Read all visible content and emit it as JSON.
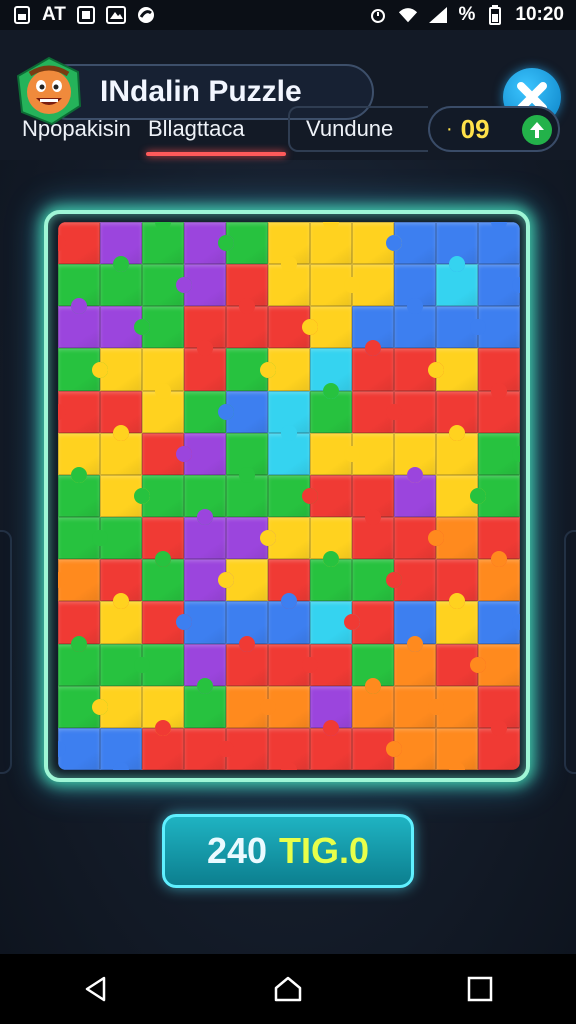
{
  "status_bar": {
    "left_text": "AT",
    "battery_percent": "%",
    "time": "10:20",
    "icons": [
      "sim-icon",
      "image-icon",
      "photo-icon",
      "brand-icon",
      "alarm-icon",
      "wifi-icon",
      "signal-icon",
      "battery-icon"
    ]
  },
  "header": {
    "title": "INdalin Puzzle",
    "avatar_icon": "cartoon-face-icon",
    "close_icon": "puzzle-close-icon"
  },
  "tabs": [
    {
      "label": "Npopakisin"
    },
    {
      "label": "Bllagttaca"
    },
    {
      "label": "Vundune"
    }
  ],
  "score": {
    "value": "09",
    "icon": "up-arrow-icon"
  },
  "board": {
    "rows": 13,
    "cols": 11,
    "palette": {
      "r": "#f03a34",
      "g": "#27c23f",
      "b": "#3d7ff0",
      "y": "#ffd21f",
      "o": "#ff8a1e",
      "p": "#9b45dd",
      "c": "#35d3f0"
    },
    "pieces": [
      "rpgpgyyybbb",
      "gggpryyybcb",
      "ppgrrrybbbb",
      "gyyrgycrryr",
      "rrygbcgrrrr",
      "yyrpgcyyyyg",
      "gyggggrrpyg",
      "ggrppyyrror",
      "orgpyrggrro",
      "ryrbbbcrbyb",
      "gggprrrgoro",
      "gyygoopooor",
      "bbrrrrrroor"
    ]
  },
  "bottom_button": {
    "count": "240",
    "label": "TIG.0"
  },
  "nav": {
    "back_icon": "back-triangle-icon",
    "home_icon": "home-icon",
    "recents_icon": "recents-square-icon"
  }
}
